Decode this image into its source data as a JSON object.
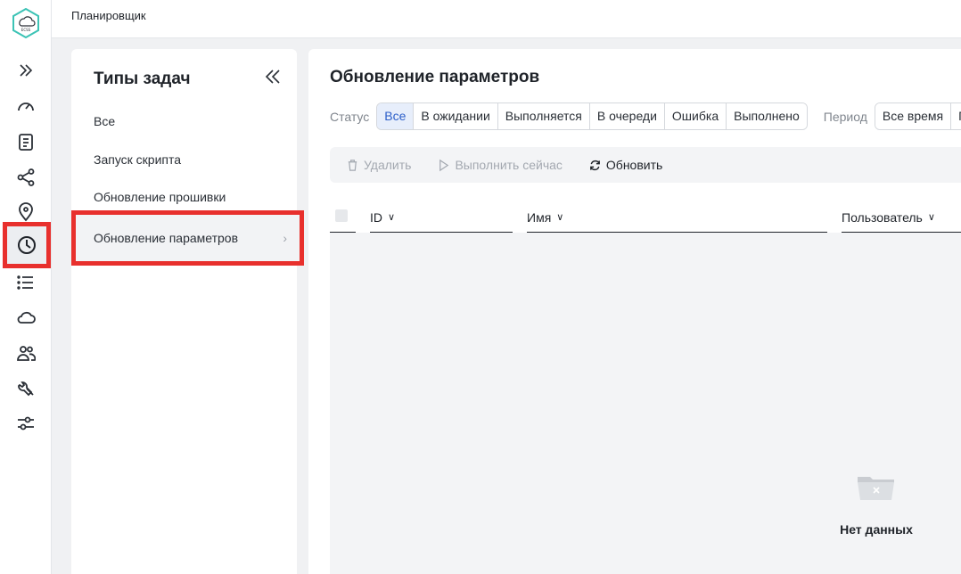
{
  "app": {
    "title": "Планировщик"
  },
  "rail": {
    "items": [
      {
        "name": "expand-icon"
      },
      {
        "name": "dashboard-icon"
      },
      {
        "name": "document-icon"
      },
      {
        "name": "share-icon"
      },
      {
        "name": "location-icon"
      },
      {
        "name": "clock-icon",
        "active": true
      },
      {
        "name": "list-icon"
      },
      {
        "name": "cloud-icon"
      },
      {
        "name": "users-icon"
      },
      {
        "name": "wrench-icon"
      },
      {
        "name": "sliders-icon"
      }
    ]
  },
  "task_types": {
    "heading": "Типы задач",
    "items": [
      {
        "label": "Все"
      },
      {
        "label": "Запуск скрипта"
      },
      {
        "label": "Обновление прошивки"
      },
      {
        "label": "Обновление параметров",
        "active": true
      }
    ]
  },
  "main": {
    "title": "Обновление параметров",
    "status_label": "Статус",
    "status_options": [
      "Все",
      "В ожидании",
      "Выполняется",
      "В очереди",
      "Ошибка",
      "Выполнено"
    ],
    "status_selected": "Все",
    "period_label": "Период",
    "period_options": [
      "Все время",
      "Го"
    ],
    "toolbar": {
      "delete": "Удалить",
      "run_now": "Выполнить сейчас",
      "refresh": "Обновить"
    },
    "columns": [
      "ID",
      "Имя",
      "Пользователь"
    ],
    "empty_text": "Нет данных"
  },
  "colors": {
    "accent": "#2c5fc9",
    "highlight": "#e8302d",
    "brand": "#3cc3b5"
  }
}
